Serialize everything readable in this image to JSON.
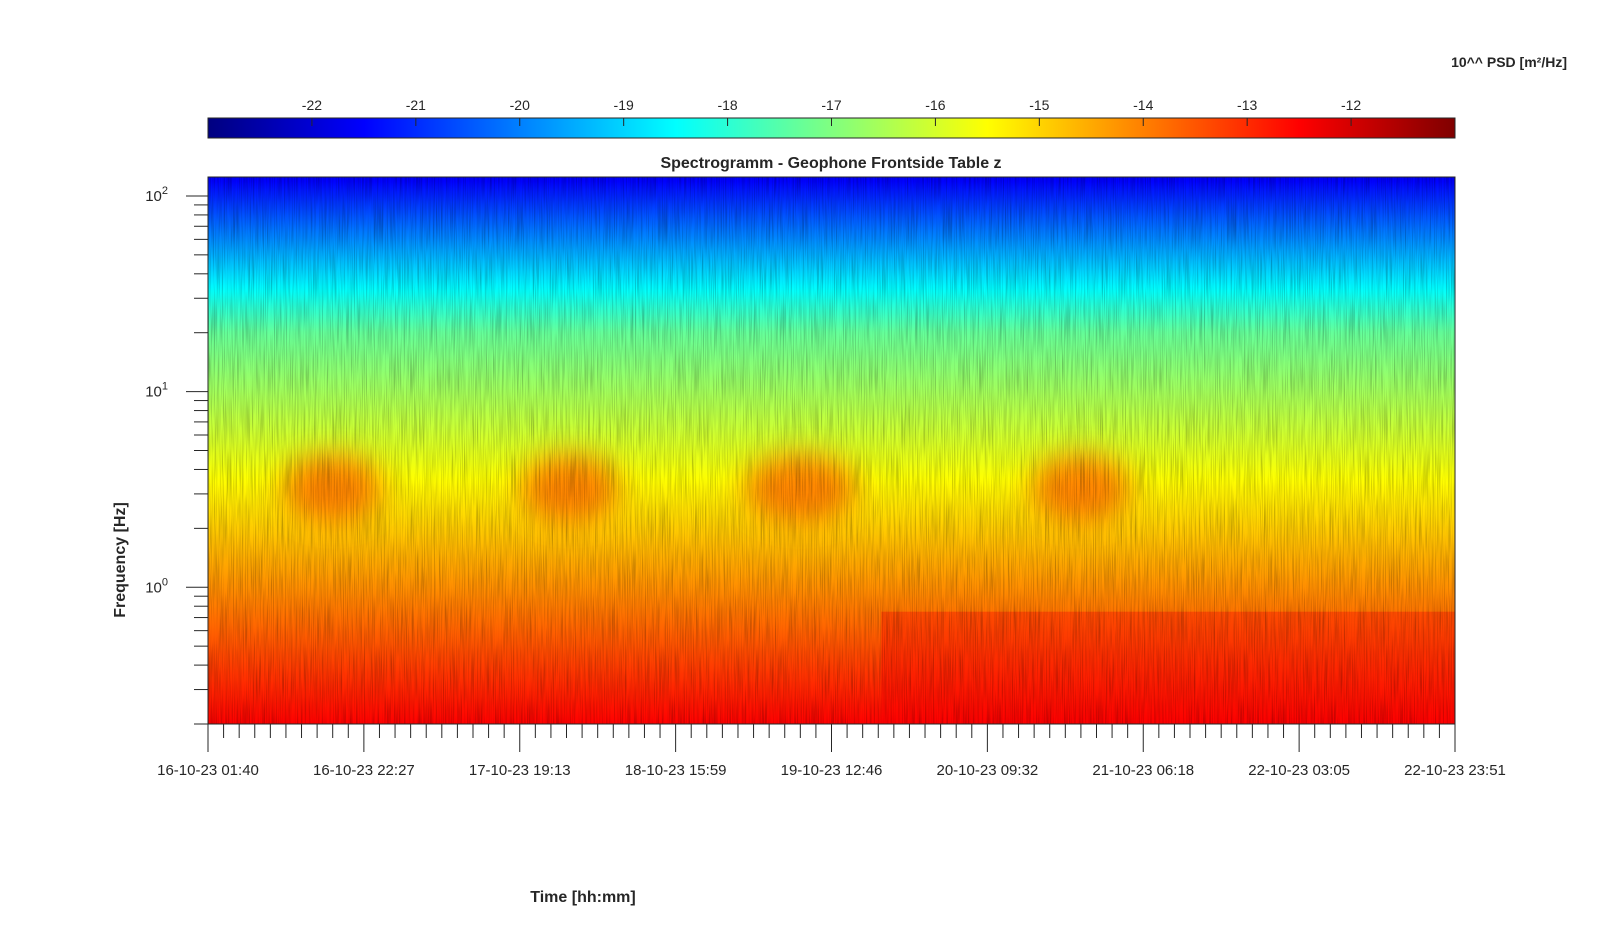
{
  "chart_data": {
    "type": "heatmap",
    "title": "Spectrogramm - Geophone Frontside Table z",
    "xlabel": "Time [hh:mm]",
    "ylabel": "Frequency [Hz]",
    "colorbar_label": "10^^ PSD [m²/Hz]",
    "colormap": "jet",
    "colorbar_range": [
      -23,
      -11
    ],
    "colorbar_ticks": [
      "-22",
      "-21",
      "-20",
      "-19",
      "-18",
      "-17",
      "-16",
      "-15",
      "-14",
      "-13",
      "-12"
    ],
    "y_scale": "log",
    "ylim": [
      0.2,
      125
    ],
    "y_ticks": [
      {
        "base": "10",
        "exp": "2",
        "value": 100
      },
      {
        "base": "10",
        "exp": "1",
        "value": 10
      },
      {
        "base": "10",
        "exp": "0",
        "value": 1
      }
    ],
    "xlim": [
      "16-10-23 01:40",
      "22-10-23 23:51"
    ],
    "x_ticks": [
      "16-10-23 01:40",
      "16-10-23 22:27",
      "17-10-23 19:13",
      "18-10-23 15:59",
      "19-10-23 12:46",
      "20-10-23 09:32",
      "21-10-23 06:18",
      "22-10-23 03:05",
      "22-10-23 23:51"
    ],
    "legend": "colorbar-top",
    "grid": false
  }
}
